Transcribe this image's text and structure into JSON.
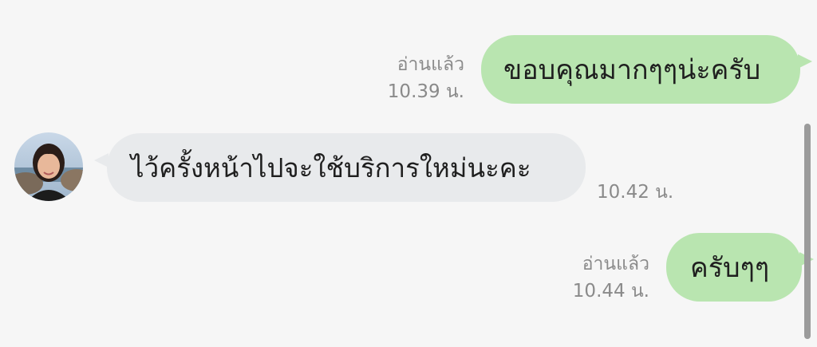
{
  "messages": [
    {
      "direction": "outgoing",
      "text": "ขอบคุณมากๆๆน่ะครับ",
      "read_status": "อ่านแล้ว",
      "time": "10.39 น."
    },
    {
      "direction": "incoming",
      "text": "ไว้ครั้งหน้าไปจะใช้บริการใหม่นะคะ",
      "time": "10.42 น."
    },
    {
      "direction": "outgoing",
      "text": "ครับๆๆ",
      "read_status": "อ่านแล้ว",
      "time": "10.44 น."
    }
  ],
  "colors": {
    "outgoing_bubble": "#b9e5b0",
    "incoming_bubble": "#e8eaec",
    "meta_text": "#8a8a8a",
    "background": "#f6f6f6"
  }
}
